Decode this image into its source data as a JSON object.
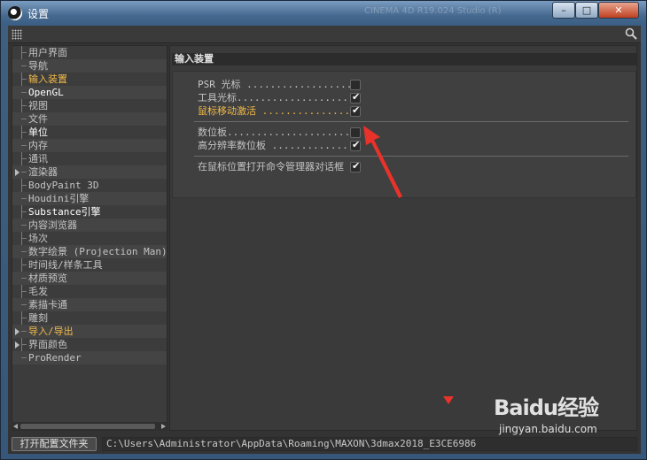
{
  "window": {
    "title": "设置",
    "bg_text": "CINEMA 4D R19.024 Studio (R)",
    "buttons": {
      "minimize": "–",
      "maximize": "□",
      "close": "✕"
    }
  },
  "tree": {
    "items": [
      {
        "label": "用户界面",
        "state": "normal",
        "expand": false
      },
      {
        "label": "导航",
        "state": "normal",
        "expand": false
      },
      {
        "label": "输入装置",
        "state": "highlight",
        "expand": false
      },
      {
        "label": "OpenGL",
        "state": "selected",
        "expand": false
      },
      {
        "label": "视图",
        "state": "normal",
        "expand": false
      },
      {
        "label": "文件",
        "state": "normal",
        "expand": false
      },
      {
        "label": "单位",
        "state": "selected",
        "expand": false
      },
      {
        "label": "内存",
        "state": "normal",
        "expand": false
      },
      {
        "label": "通讯",
        "state": "normal",
        "expand": false
      },
      {
        "label": "渲染器",
        "state": "normal",
        "expand": true
      },
      {
        "label": "BodyPaint 3D",
        "state": "normal",
        "expand": false
      },
      {
        "label": "Houdini引擎",
        "state": "normal",
        "expand": false
      },
      {
        "label": "Substance引擎",
        "state": "selected",
        "expand": false
      },
      {
        "label": "内容浏览器",
        "state": "normal",
        "expand": false
      },
      {
        "label": "场次",
        "state": "normal",
        "expand": false
      },
      {
        "label": "数字绘景 (Projection Man)",
        "state": "normal",
        "expand": false
      },
      {
        "label": "时间线/样条工具",
        "state": "normal",
        "expand": false
      },
      {
        "label": "材质预览",
        "state": "normal",
        "expand": false
      },
      {
        "label": "毛发",
        "state": "normal",
        "expand": false
      },
      {
        "label": "素描卡通",
        "state": "normal",
        "expand": false
      },
      {
        "label": "雕刻",
        "state": "normal",
        "expand": false
      },
      {
        "label": "导入/导出",
        "state": "highlight",
        "expand": true
      },
      {
        "label": "界面颜色",
        "state": "normal",
        "expand": true
      },
      {
        "label": "ProRender",
        "state": "normal",
        "expand": false
      }
    ]
  },
  "panel": {
    "header": "输入装置",
    "options": [
      {
        "label": "PSR 光标 ...................",
        "checked": false,
        "highlight": false
      },
      {
        "label": "工具光标....................",
        "checked": true,
        "highlight": false
      },
      {
        "label": "鼠标移动激活 .................",
        "checked": true,
        "highlight": true
      },
      {
        "label": "数位板.......................",
        "checked": false,
        "highlight": false
      },
      {
        "label": "高分辨率数位板 ..............",
        "checked": true,
        "highlight": false
      },
      {
        "label": "在鼠标位置打开命令管理器对话框",
        "checked": true,
        "highlight": false
      }
    ]
  },
  "bottom": {
    "open_folder_button": "打开配置文件夹",
    "path": "C:\\Users\\Administrator\\AppData\\Roaming\\MAXON\\3dmax2018_E3CE6986"
  },
  "watermark": {
    "logo": "Baidu经验",
    "url": "jingyan.baidu.com"
  },
  "colors": {
    "highlight": "#f1b94a",
    "annotation_red": "#e8322a",
    "panel_bg": "#3a3a3a"
  }
}
